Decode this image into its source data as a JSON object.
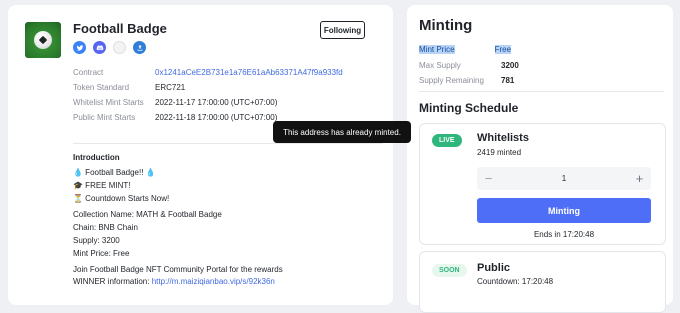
{
  "project": {
    "name": "Football Badge",
    "follow_label": "Following",
    "socials": [
      "twitter-icon",
      "discord-icon",
      "website-icon",
      "share-icon"
    ]
  },
  "details": [
    {
      "label": "Contract",
      "value": "0x1241aCeE2B731e1a76E61aAb63371A47f9a933fd"
    },
    {
      "label": "Token Standard",
      "value": "ERC721"
    },
    {
      "label": "Whitelist Mint Starts",
      "value": "2022-11-17 17:00:00 (UTC+07:00)"
    },
    {
      "label": "Public Mint Starts",
      "value": "2022-11-18 17:00:00 (UTC+07:00)"
    }
  ],
  "intro": {
    "title": "Introduction",
    "lines": [
      "💧 Football Badge!! 💧",
      "🎓 FREE MINT!",
      "⏳ Countdown Starts Now!",
      "Collection Name: MATH & Football Badge",
      "Chain: BNB Chain",
      "Supply: 3200",
      "Mint Price: Free",
      "Join Football Badge NFT Community Portal for the rewards"
    ],
    "winner_label": "WINNER information: ",
    "winner_link": "http://m.maiziqianbao.vip/s/92k36n"
  },
  "tooltip": "This address has already minted.",
  "minting": {
    "title": "Minting",
    "rows": [
      {
        "label": "Mint Price",
        "value": "Free"
      },
      {
        "label": "Max Supply",
        "value": "3200"
      },
      {
        "label": "Supply Remaining",
        "value": "781"
      }
    ]
  },
  "schedule": {
    "title": "Minting Schedule",
    "whitelist": {
      "badge": "LIVE",
      "name": "Whitelists",
      "minted": "2419 minted",
      "quantity": "1",
      "minus": "−",
      "plus": "+",
      "mint_label": "Minting",
      "ends": "Ends in 17:20:48"
    },
    "public": {
      "badge": "SOON",
      "name": "Public",
      "countdown": "Countdown: 17:20:48"
    }
  },
  "colors": {
    "accent": "#4f6ef7",
    "live": "#2eb67d",
    "link": "#4169e1"
  }
}
